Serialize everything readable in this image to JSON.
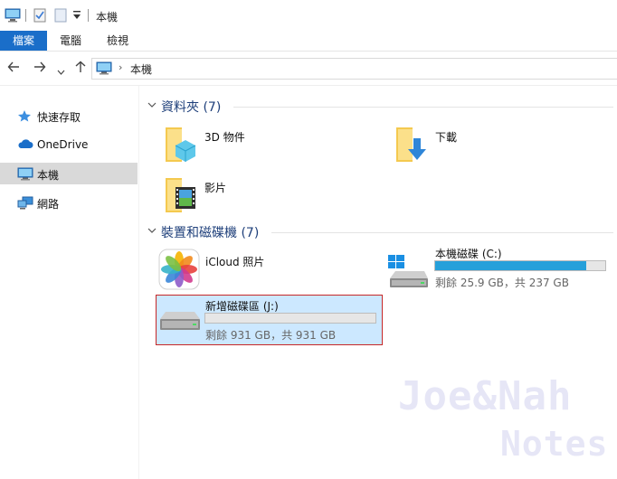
{
  "window": {
    "title": "本機"
  },
  "ribbon": {
    "tabs": [
      "檔案",
      "電腦",
      "檢視"
    ]
  },
  "address": {
    "location": "本機"
  },
  "sidebar": {
    "items": [
      {
        "label": "快速存取",
        "icon": "star-pin-icon",
        "selected": false
      },
      {
        "label": "OneDrive",
        "icon": "cloud-icon",
        "selected": false
      },
      {
        "label": "本機",
        "icon": "computer-icon",
        "selected": true
      },
      {
        "label": "網路",
        "icon": "network-icon",
        "selected": false
      }
    ]
  },
  "sections": {
    "folders": {
      "title": "資料夾 (7)"
    },
    "devices": {
      "title": "裝置和磁碟機 (7)"
    }
  },
  "folders": [
    {
      "label": "3D 物件",
      "icon": "3d-objects-folder-icon"
    },
    {
      "label": "下載",
      "icon": "downloads-folder-icon"
    },
    {
      "label": "影片",
      "icon": "videos-folder-icon"
    }
  ],
  "devices": {
    "icloud": {
      "label": "iCloud 照片",
      "icon": "icloud-photos-icon"
    },
    "c_drive": {
      "name": "本機磁碟 (C:)",
      "free_text": "剩餘 25.9 GB，共 237 GB",
      "used_fraction": 0.89,
      "bar_color": "#26a0da"
    },
    "j_drive": {
      "name": "新增磁碟區 (J:)",
      "free_text": "剩餘 931 GB，共 931 GB",
      "used_fraction": 0.0,
      "bar_color": "#26a0da"
    }
  },
  "watermark": {
    "line1": "Joe&Nah",
    "line2": "Notes"
  }
}
